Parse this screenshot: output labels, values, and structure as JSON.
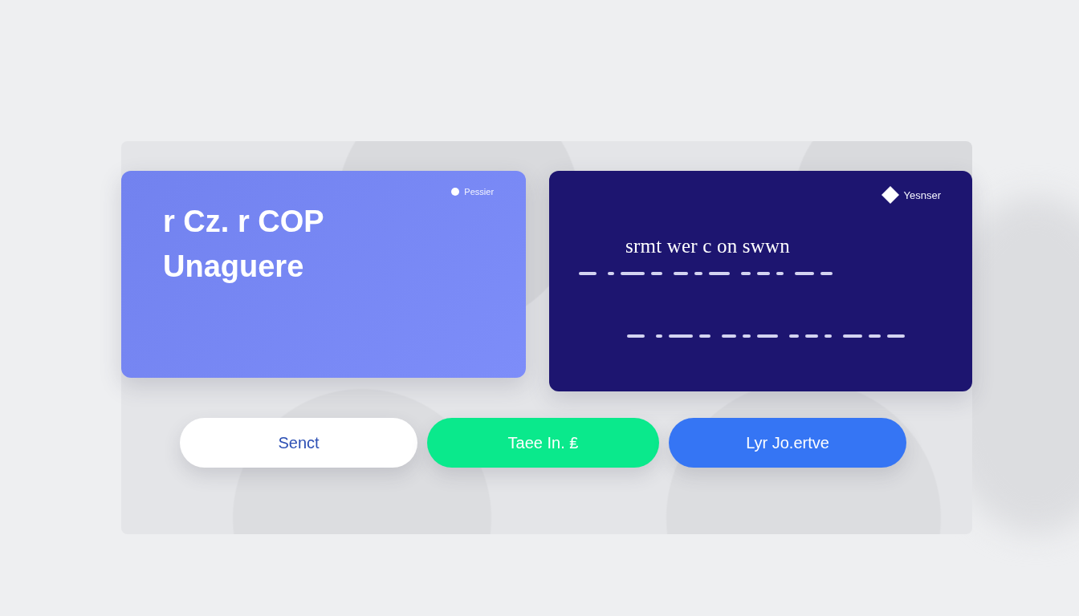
{
  "cards": [
    {
      "kind": "light",
      "badge": "Pessier",
      "title_lines": [
        "r Cz. r COP",
        "Unaguere"
      ]
    },
    {
      "kind": "dark",
      "badge": "Yesnser",
      "title_lines": [
        "srmt wer c on swwn"
      ]
    }
  ],
  "buttons": [
    {
      "kind": "outline",
      "label": "Senct"
    },
    {
      "kind": "success",
      "label": "Taee In. ₤"
    },
    {
      "kind": "primary",
      "label": "Lyr Jo.ertve"
    }
  ]
}
